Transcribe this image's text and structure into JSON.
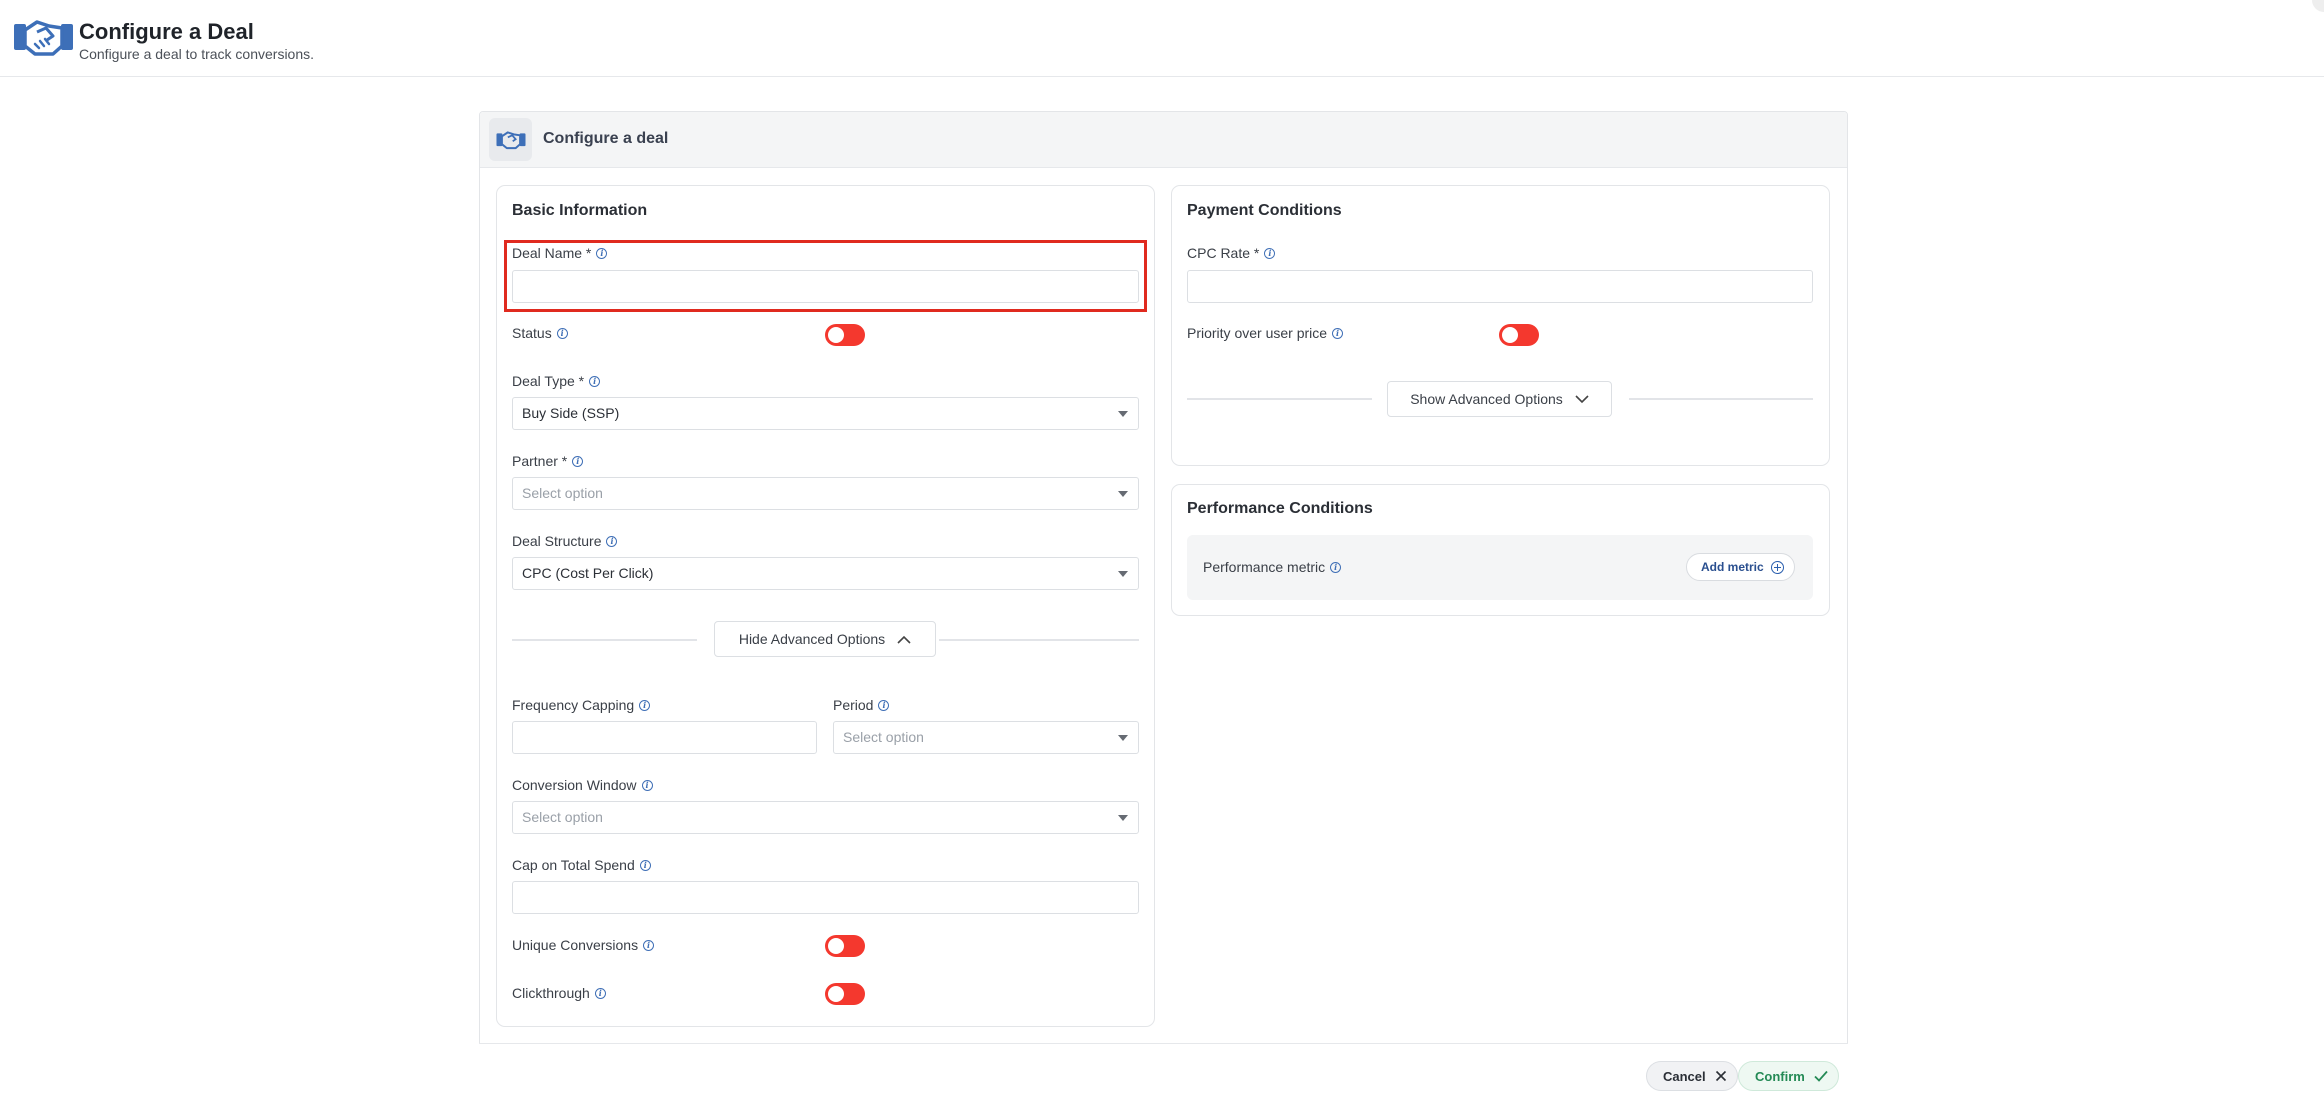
{
  "header": {
    "title": "Configure a Deal",
    "subtitle": "Configure a deal to track conversions.",
    "logo_icon": "handshake-icon"
  },
  "panel": {
    "title": "Configure a deal",
    "icon": "handshake-icon"
  },
  "basic": {
    "title": "Basic Information",
    "deal_name_label": "Deal Name *",
    "deal_name_value": "",
    "status_label": "Status",
    "status_on": false,
    "deal_type_label": "Deal Type *",
    "deal_type_value": "Buy Side (SSP)",
    "partner_label": "Partner *",
    "partner_placeholder": "Select option",
    "deal_structure_label": "Deal Structure",
    "deal_structure_value": "CPC (Cost Per Click)",
    "advanced_toggle_label": "Hide Advanced Options",
    "frequency_capping_label": "Frequency Capping",
    "frequency_capping_value": "",
    "period_label": "Period",
    "period_placeholder": "Select option",
    "conversion_window_label": "Conversion Window",
    "conversion_window_placeholder": "Select option",
    "cap_total_spend_label": "Cap on Total Spend",
    "cap_total_spend_value": "",
    "unique_conversions_label": "Unique Conversions",
    "unique_conversions_on": false,
    "clickthrough_label": "Clickthrough",
    "clickthrough_on": false
  },
  "payment": {
    "title": "Payment Conditions",
    "cpc_rate_label": "CPC Rate *",
    "cpc_rate_value": "",
    "priority_label": "Priority over user price",
    "priority_on": false,
    "advanced_toggle_label": "Show Advanced Options"
  },
  "performance": {
    "title": "Performance Conditions",
    "metric_label": "Performance metric",
    "add_metric_label": "Add metric"
  },
  "footer": {
    "cancel_label": "Cancel",
    "confirm_label": "Confirm"
  },
  "colors": {
    "toggle_off": "#f4382e",
    "highlight": "#e02a1f",
    "brand": "#2a5fae",
    "confirm": "#248a55"
  }
}
